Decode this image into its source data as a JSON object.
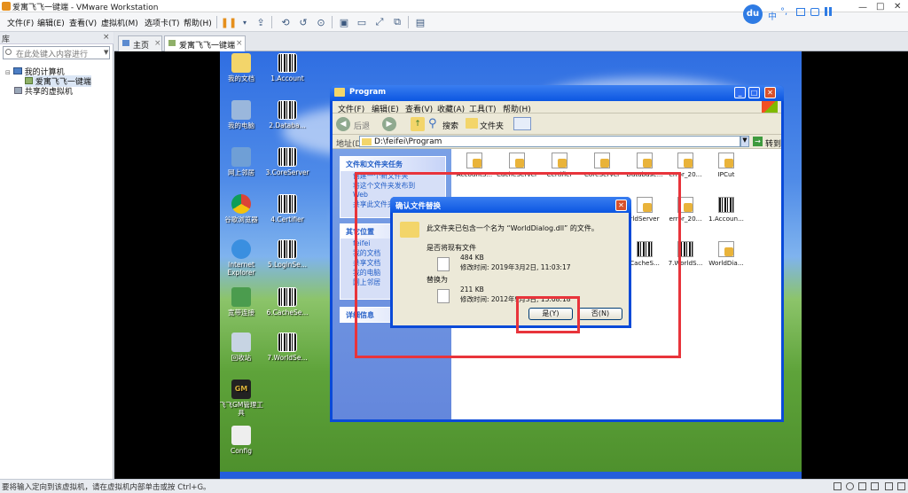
{
  "window": {
    "title": "爱寓飞飞一键端 - VMware Workstation"
  },
  "menubar": {
    "items": [
      "文件(F)",
      "编辑(E)",
      "查看(V)",
      "虚拟机(M)",
      "选项卡(T)",
      "帮助(H)"
    ]
  },
  "tray": {
    "items": [
      "中",
      "°,",
      "du"
    ]
  },
  "library": {
    "title": "库",
    "search_placeholder": "在此处键入内容进行",
    "tree": [
      "我的计算机",
      "爱寓飞飞一键端",
      "共享的虚拟机"
    ]
  },
  "tabs": [
    {
      "label": "主页"
    },
    {
      "label": "爱寓飞飞一键端"
    }
  ],
  "status": {
    "text": "要将输入定向到该虚拟机，请在虚拟机内部单击或按 Ctrl+G。"
  },
  "desktop_icons": [
    "我的文档",
    "1.Account",
    "我的电脑",
    "2.Databa...",
    "网上邻居",
    "3.CoreServer",
    "谷歌浏览器",
    "4.Certifier",
    "Internet Explorer",
    "5.LoginSe...",
    "宽带连接",
    "6.CacheSe...",
    "回收站",
    "7.WorldSe...",
    "飞飞GM管理工具",
    "Config"
  ],
  "explorer": {
    "title": "Program",
    "menu": [
      "文件(F)",
      "编辑(E)",
      "查看(V)",
      "收藏(A)",
      "工具(T)",
      "帮助(H)"
    ],
    "toolbar": {
      "back": "后退",
      "search": "搜索",
      "folders": "文件夹"
    },
    "address_label": "地址(D)",
    "address": "D:\\feifei\\Program",
    "go": "转到",
    "side": {
      "tasks_title": "文件和文件夹任务",
      "tasks": [
        "创建一个新文件夹",
        "将这个文件夹发布到 Web",
        "共享此文件夹"
      ],
      "places_title": "其它位置",
      "places": [
        "feifei",
        "我的文档",
        "共享文档",
        "我的电脑",
        "网上邻居"
      ],
      "details_title": "详细信息"
    },
    "files": [
      "AccountS...",
      "CacheServer",
      "Certifier",
      "CoreServer",
      "Database...",
      "error_20...",
      "IPCut",
      "rldServer",
      "error_20...",
      "1.Accoun...",
      "CacheS...",
      "7.WorldS...",
      "WorldDia..."
    ]
  },
  "dialog": {
    "title": "确认文件替换",
    "message": "此文件夹已包含一个名为 “WorldDialog.dll” 的文件。",
    "question": "是否将现有文件",
    "existing": {
      "size": "484 KB",
      "modified": "修改时间: 2019年3月2日, 11:03:17"
    },
    "replace_with": "替换为",
    "new": {
      "size": "211 KB",
      "modified": "修改时间: 2012年9月3日, 15:08:18"
    },
    "yes": "是(Y)",
    "no": "否(N)"
  },
  "colors": {
    "highlight": "#e8343b",
    "xp_blue": "#0b56e2",
    "xp_face": "#ece9d8"
  }
}
